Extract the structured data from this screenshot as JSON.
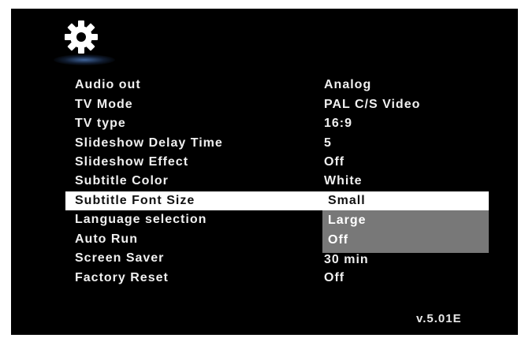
{
  "settings": {
    "icon": "gear-icon",
    "items": [
      {
        "label": "Audio out",
        "value": "Analog"
      },
      {
        "label": "TV Mode",
        "value": "PAL C/S Video"
      },
      {
        "label": "TV type",
        "value": "16:9"
      },
      {
        "label": "Slideshow Delay Time",
        "value": "5"
      },
      {
        "label": "Slideshow Effect",
        "value": "Off"
      },
      {
        "label": "Subtitle Color",
        "value": "White"
      },
      {
        "label": "Subtitle Font Size",
        "value": ""
      },
      {
        "label": "Language selection",
        "value": ""
      },
      {
        "label": "Auto Run",
        "value": ""
      },
      {
        "label": "Screen Saver",
        "value": "30 min"
      },
      {
        "label": "Factory Reset",
        "value": "Off"
      }
    ],
    "selected_index": 6
  },
  "dropdown": {
    "options": [
      "Small",
      "Large",
      "Off"
    ],
    "highlighted_option": "Small"
  },
  "version": "v.5.01E",
  "colors": {
    "background": "#000000",
    "text": "#f0f0f0",
    "highlight": "#ffffff",
    "dropdown_bg": "#787878"
  }
}
